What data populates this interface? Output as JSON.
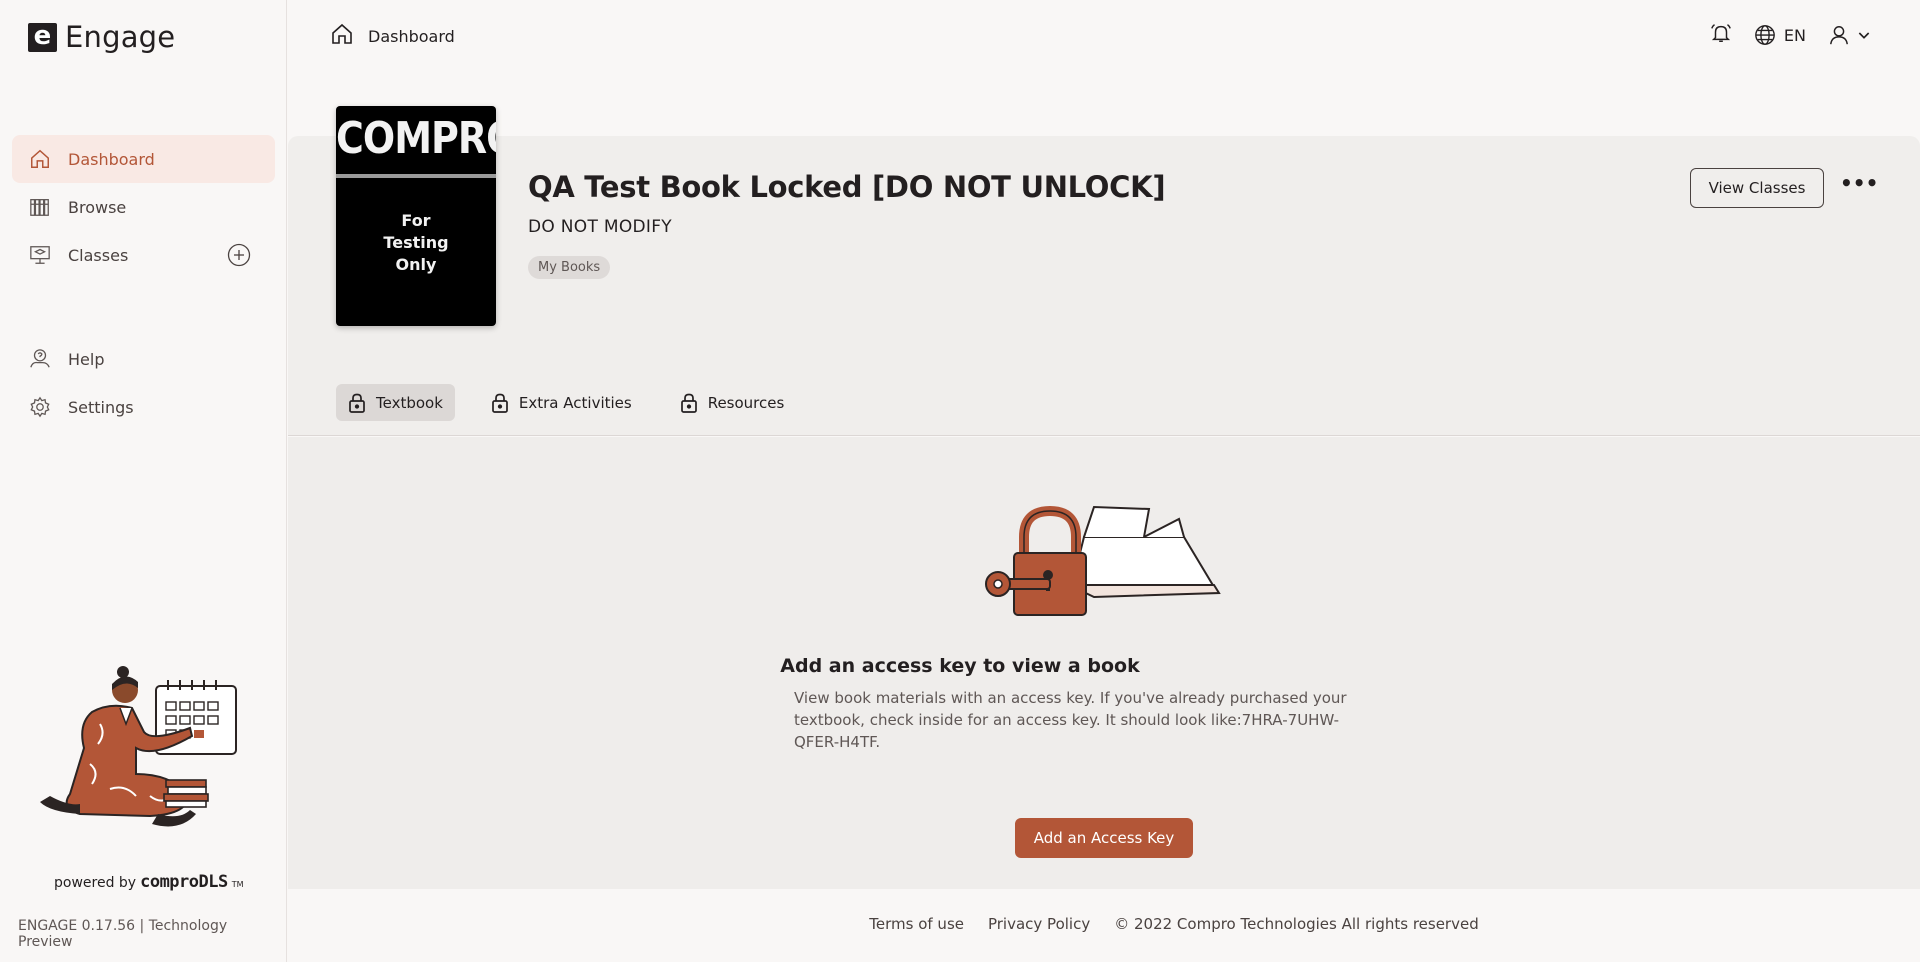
{
  "app": {
    "logo_letter": "e",
    "logo_text": "Engage"
  },
  "sidebar": {
    "items": [
      {
        "label": "Dashboard",
        "icon": "home-icon",
        "active": true
      },
      {
        "label": "Browse",
        "icon": "library-icon"
      },
      {
        "label": "Classes",
        "icon": "classroom-icon"
      }
    ],
    "secondary": [
      {
        "label": "Help",
        "icon": "help-icon"
      },
      {
        "label": "Settings",
        "icon": "gear-icon"
      }
    ],
    "powered_prefix": "powered by",
    "powered_brand": "comproDLS",
    "powered_tm": "TM",
    "version": "ENGAGE 0.17.56 | Technology Preview"
  },
  "topbar": {
    "breadcrumb": "Dashboard",
    "language": "EN"
  },
  "book": {
    "cover_brand": "COMPRO",
    "cover_line1": "For",
    "cover_line2": "Testing",
    "cover_line3": "Only",
    "title": "QA Test Book Locked [DO NOT UNLOCK]",
    "subtitle": "DO NOT MODIFY",
    "tag": "My Books",
    "view_classes": "View Classes"
  },
  "tabs": [
    {
      "label": "Textbook",
      "active": true
    },
    {
      "label": "Extra Activities"
    },
    {
      "label": "Resources"
    }
  ],
  "empty_state": {
    "title": "Add an access key to view a book",
    "text": "View book materials with an access key. If you've already purchased your textbook, check inside for an access key. It should look like:7HRA-7UHW-QFER-H4TF.",
    "button": "Add an Access Key"
  },
  "footer": {
    "terms": "Terms of use",
    "privacy": "Privacy Policy",
    "copyright": "© 2022 Compro Technologies All rights reserved"
  },
  "colors": {
    "accent": "#b35637",
    "active_bg": "#f9e9e4",
    "text": "#231f20"
  }
}
